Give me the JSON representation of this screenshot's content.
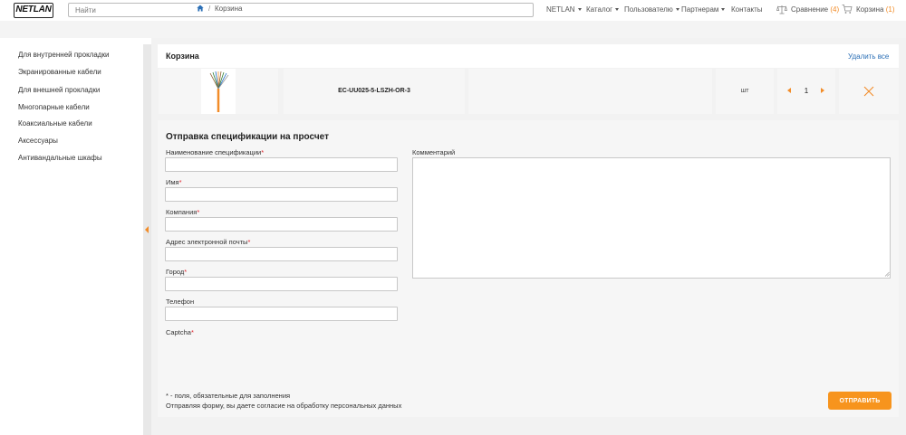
{
  "header": {
    "logo_text": "NETLAN",
    "search_placeholder": "Найти",
    "nav": [
      {
        "label": "NETLAN",
        "has_caret": true
      },
      {
        "label": "Каталог",
        "has_caret": true
      },
      {
        "label": "Пользователю",
        "has_caret": true
      },
      {
        "label": "Партнерам",
        "has_caret": true
      },
      {
        "label": "Контакты",
        "has_caret": false
      }
    ],
    "compare": {
      "label": "Сравнение",
      "count": "(4)",
      "icon": "scales-icon"
    },
    "cart": {
      "label": "Корзина",
      "count": "(1)",
      "icon": "cart-icon"
    }
  },
  "breadcrumb": {
    "home_icon": "home-icon",
    "separator": "/",
    "current": "Корзина"
  },
  "sidebar": {
    "items": [
      "Для внутренней прокладки",
      "Экранированные кабели",
      "Для внешней прокладки",
      "Многопарные кабели",
      "Коаксиальные кабели",
      "Аксессуары",
      "Антивандальные шкафы"
    ]
  },
  "cart": {
    "title": "Корзина",
    "delete_all": "Удалить все",
    "item": {
      "sku": "EC-UU025-5-LSZH-OR-3",
      "unit": "шт",
      "quantity": "1"
    }
  },
  "form": {
    "title": "Отправка спецификации на просчет",
    "fields": [
      {
        "label": "Наименование спецификации",
        "required": "*",
        "value": ""
      },
      {
        "label": "Имя",
        "required": "*",
        "value": ""
      },
      {
        "label": "Компания",
        "required": "*",
        "value": ""
      },
      {
        "label": "Адрес электронной почты",
        "required": "*",
        "value": ""
      },
      {
        "label": "Город",
        "required": "*",
        "value": ""
      },
      {
        "label": "Телефон",
        "required": "",
        "value": ""
      }
    ],
    "captcha": {
      "label": "Captcha",
      "required": "*"
    },
    "comment_label": "Комментарий",
    "required_note": "* - поля, обязательные для заполнения",
    "consent_note": "Отправляя форму, вы даете согласие на обработку персональных данных",
    "submit_label": "ОТПРАВИТЬ"
  },
  "colors": {
    "accent": "#f7941d",
    "link": "#2b6fb6",
    "required": "#e0202a"
  }
}
